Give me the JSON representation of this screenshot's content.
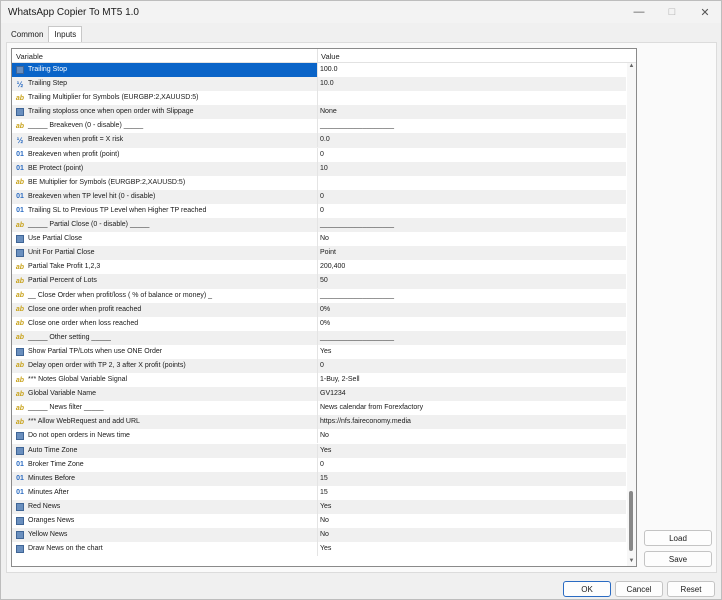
{
  "window": {
    "title": "WhatsApp Copier To MT5 1.0"
  },
  "tabs": [
    {
      "label": "Common"
    },
    {
      "label": "Inputs"
    }
  ],
  "grid": {
    "columns": {
      "variable": "Variable",
      "value": "Value"
    },
    "rows": [
      {
        "icon": "enum-icon",
        "name": "Trailing Stop",
        "value": "100.0",
        "selected": true
      },
      {
        "icon": "fraction-icon",
        "name": "Trailing Step",
        "value": "10.0"
      },
      {
        "icon": "string-icon",
        "name": "Trailing Multiplier for Symbols (EURGBP:2,XAUUSD:5)",
        "value": ""
      },
      {
        "icon": "enum-icon",
        "name": "Trailing stoploss once when open order with Slippage",
        "value": "None"
      },
      {
        "icon": "string-icon",
        "name": "_____ Breakeven (0 - disable) _____",
        "value": "___________________"
      },
      {
        "icon": "fraction-icon",
        "name": "Breakeven when profit = X risk",
        "value": "0.0"
      },
      {
        "icon": "integer-icon",
        "name": "Breakeven when profit (point)",
        "value": "0"
      },
      {
        "icon": "integer-icon",
        "name": "BE Protect (point)",
        "value": "10"
      },
      {
        "icon": "string-icon",
        "name": "BE Multiplier for Symbols (EURGBP:2,XAUUSD:5)",
        "value": ""
      },
      {
        "icon": "integer-icon",
        "name": "Breakeven when TP level hit (0 - disable)",
        "value": "0"
      },
      {
        "icon": "integer-icon",
        "name": "Trailing SL to Previous TP Level when Higher TP reached",
        "value": "0"
      },
      {
        "icon": "string-icon",
        "name": "_____ Partial Close (0 - disable) _____",
        "value": "___________________"
      },
      {
        "icon": "enum-icon",
        "name": "Use Partial Close",
        "value": "No"
      },
      {
        "icon": "enum-icon",
        "name": "Unit For Partial Close",
        "value": "Point"
      },
      {
        "icon": "string-icon",
        "name": "Partial Take Profit 1,2,3",
        "value": "200,400"
      },
      {
        "icon": "string-icon",
        "name": "Partial Percent of Lots",
        "value": "50"
      },
      {
        "icon": "string-icon",
        "name": "__ Close Order when profit/loss ( % of balance or money) _",
        "value": "___________________"
      },
      {
        "icon": "string-icon",
        "name": "Close one order when profit reached",
        "value": "0%"
      },
      {
        "icon": "string-icon",
        "name": "Close one order when loss reached",
        "value": "0%"
      },
      {
        "icon": "string-icon",
        "name": "_____ Other setting _____",
        "value": "___________________"
      },
      {
        "icon": "enum-icon",
        "name": "Show Partial TP/Lots when use ONE Order",
        "value": "Yes"
      },
      {
        "icon": "string-icon",
        "name": "Delay open order with TP 2, 3 after X profit (points)",
        "value": "0"
      },
      {
        "icon": "string-icon",
        "name": "*** Notes Global Variable Signal",
        "value": "1-Buy, 2-Sell"
      },
      {
        "icon": "string-icon",
        "name": "Global Variable Name",
        "value": "GV1234"
      },
      {
        "icon": "string-icon",
        "name": "_____ News filter _____",
        "value": "News calendar from Forexfactory"
      },
      {
        "icon": "string-icon",
        "name": "*** Allow WebRequest and add URL",
        "value": "https://nfs.faireconomy.media"
      },
      {
        "icon": "enum-icon",
        "name": "Do not open orders in News time",
        "value": "No"
      },
      {
        "icon": "enum-icon",
        "name": "Auto Time Zone",
        "value": "Yes"
      },
      {
        "icon": "integer-icon",
        "name": "Broker Time Zone",
        "value": "0"
      },
      {
        "icon": "integer-icon",
        "name": "Minutes Before",
        "value": "15"
      },
      {
        "icon": "integer-icon",
        "name": "Minutes After",
        "value": "15"
      },
      {
        "icon": "enum-icon",
        "name": "Red News",
        "value": "Yes"
      },
      {
        "icon": "enum-icon",
        "name": "Oranges News",
        "value": "No"
      },
      {
        "icon": "enum-icon",
        "name": "Yellow News",
        "value": "No"
      },
      {
        "icon": "enum-icon",
        "name": "Draw News on the chart",
        "value": "Yes"
      }
    ]
  },
  "buttons": {
    "load": "Load",
    "save": "Save",
    "ok": "OK",
    "cancel": "Cancel",
    "reset": "Reset"
  },
  "colors": {
    "selection": "#0a64c8",
    "string_icon": "#c8a21a",
    "numeric_icon": "#2a6bc2"
  }
}
